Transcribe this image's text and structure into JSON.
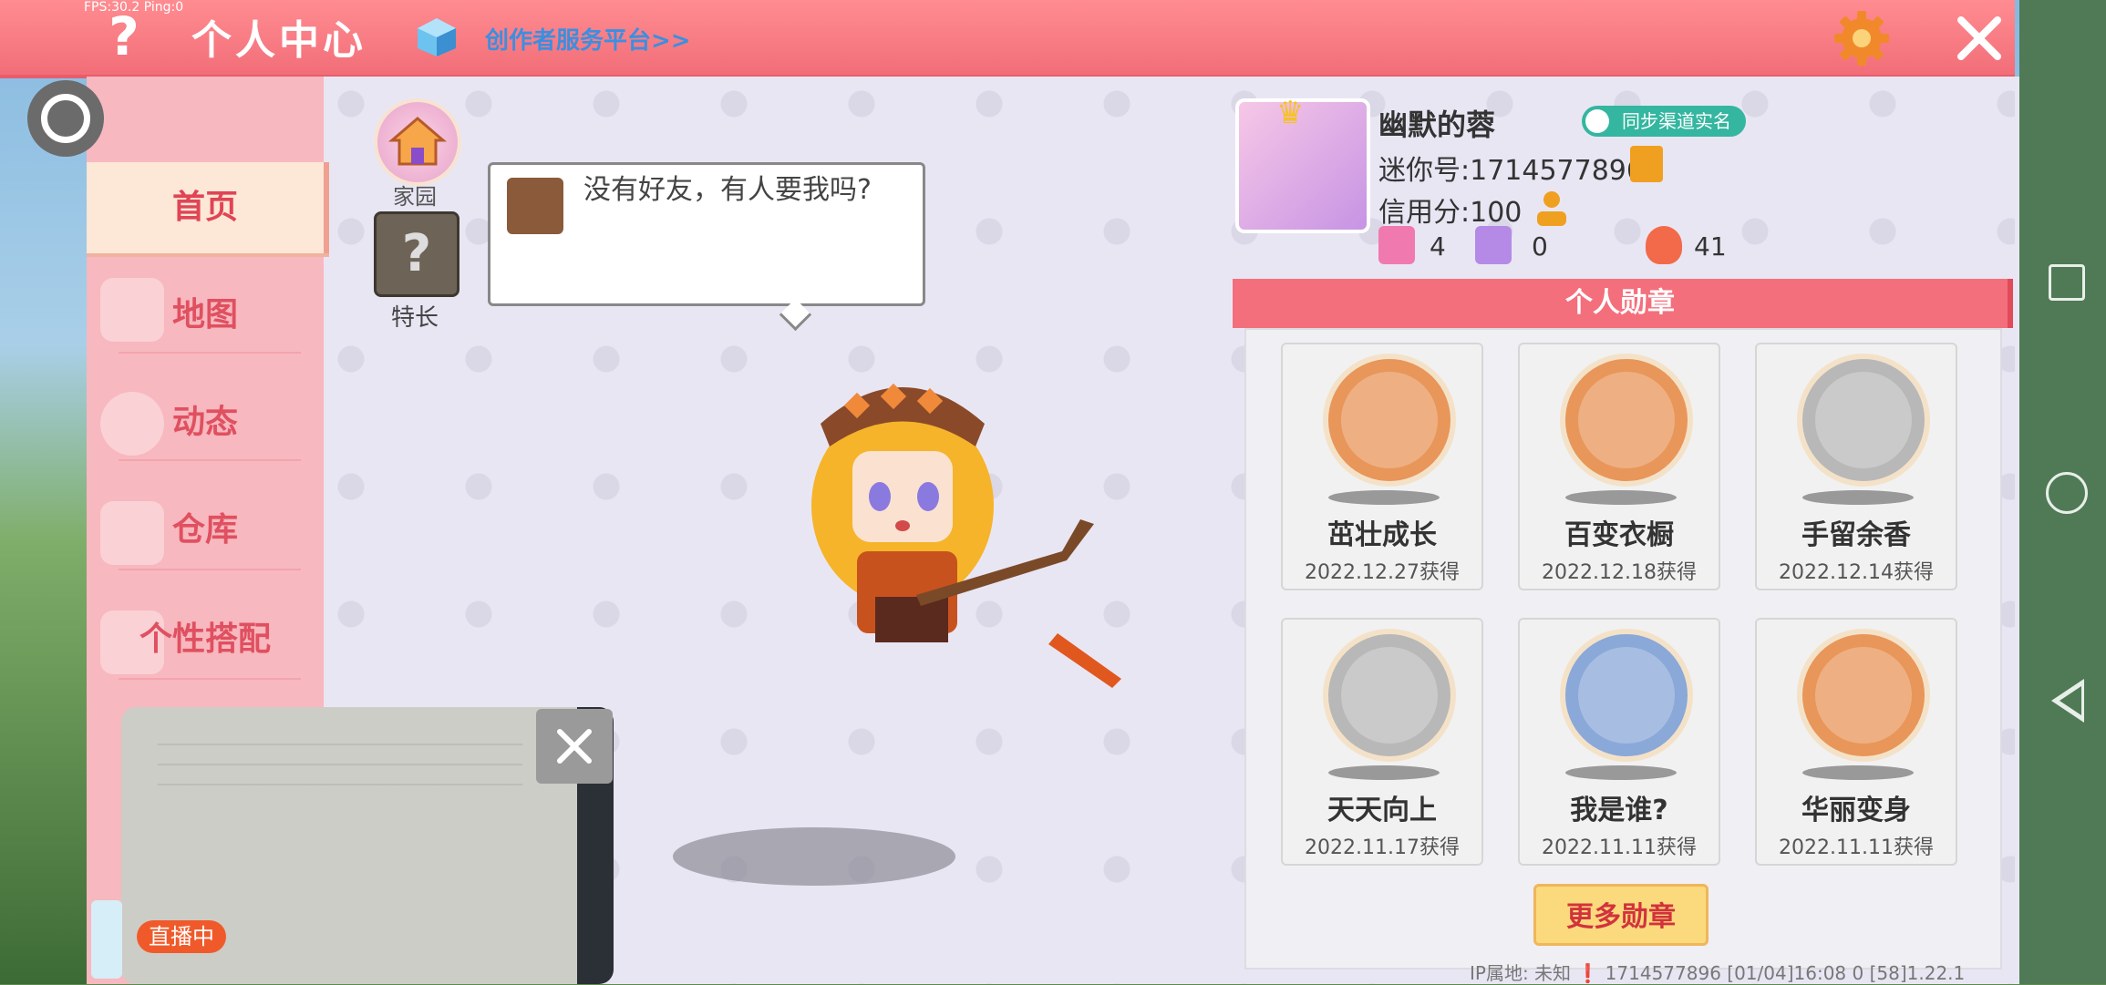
{
  "status": {
    "fps": "FPS:30.2  Ping:0"
  },
  "header": {
    "title": "个人中心",
    "creator_link": "创作者服务平台>>"
  },
  "sidebar": {
    "items": [
      {
        "label": "首页",
        "active": true
      },
      {
        "label": "地图"
      },
      {
        "label": "动态"
      },
      {
        "label": "仓库"
      },
      {
        "label": "个性搭配"
      }
    ]
  },
  "home": {
    "home_label": "家园",
    "skill_label": "特长"
  },
  "bubble": {
    "text": "没有好友，有人要我吗?"
  },
  "profile": {
    "nickname": "幽默的蓉",
    "realname_badge": "同步渠道实名",
    "mini_id": "迷你号:1714577896",
    "credit": "信用分:100",
    "stats": [
      {
        "icon": "plus-flag-icon",
        "value": "4"
      },
      {
        "icon": "trophy-person-icon",
        "value": "0"
      },
      {
        "icon": "flame-icon",
        "value": "41"
      }
    ]
  },
  "medals": {
    "header": "个人勋章",
    "items": [
      {
        "name": "茁壮成长",
        "date": "2022.12.27获得",
        "color": "#e8965a"
      },
      {
        "name": "百变衣橱",
        "date": "2022.12.18获得",
        "color": "#e8965a"
      },
      {
        "name": "手留余香",
        "date": "2022.12.14获得",
        "color": "#b8b8b8"
      },
      {
        "name": "天天向上",
        "date": "2022.11.17获得",
        "color": "#b8b8b8"
      },
      {
        "name": "我是谁?",
        "date": "2022.11.11获得",
        "color": "#8aa8d8"
      },
      {
        "name": "华丽变身",
        "date": "2022.11.11获得",
        "color": "#e8965a"
      }
    ],
    "more_button": "更多勋章"
  },
  "footer": {
    "text": "IP属地: 未知 ❗    1714577896    [01/04]16:08 0  [58]1.22.1"
  },
  "live": {
    "badge": "直播中"
  }
}
